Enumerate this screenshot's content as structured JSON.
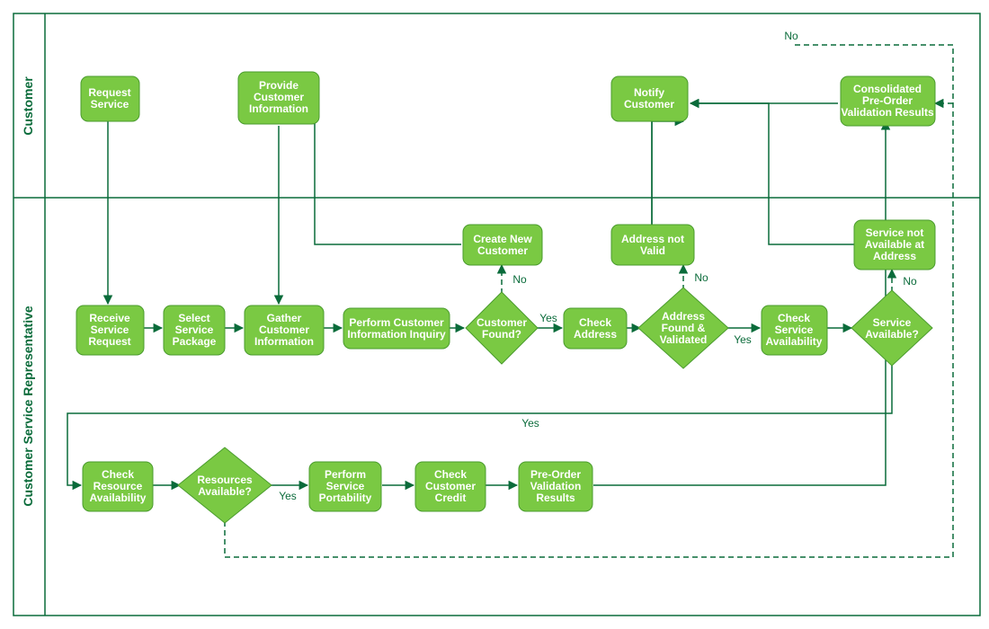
{
  "lanes": {
    "customer": "Customer",
    "csr": "Customer Service Representative"
  },
  "nodes": {
    "request_service": "Request\nService",
    "provide_customer_info": "Provide\nCustomer\nInformation",
    "notify_customer": "Notify\nCustomer",
    "consolidated_results": "Consolidated\nPre-Order\nValidation Results",
    "receive_service_request": "Receive\nService\nRequest",
    "select_service_package": "Select\nService\nPackage",
    "gather_customer_info": "Gather\nCustomer\nInformation",
    "perform_customer_inquiry": "Perform Customer\nInformation Inquiry",
    "customer_found": "Customer\nFound?",
    "create_new_customer": "Create New\nCustomer",
    "check_address": "Check\nAddress",
    "address_validated": "Address\nFound &\nValidated",
    "address_not_valid": "Address not\nValid",
    "check_service_avail": "Check\nService\nAvailability",
    "service_available": "Service\nAvailable?",
    "service_not_available": "Service not\nAvailable at\nAddress",
    "check_resource_avail": "Check\nResource\nAvailability",
    "resources_available": "Resources\nAvailable?",
    "perform_service_portability": "Perform\nService\nPortability",
    "check_customer_credit": "Check\nCustomer\nCredit",
    "preorder_validation_results": "Pre-Order\nValidation\nResults"
  },
  "labels": {
    "yes": "Yes",
    "no": "No"
  },
  "colors": {
    "node_fill": "#7ac943",
    "node_stroke": "#4a9c2e",
    "line": "#0a6b3a"
  },
  "chart_data": {
    "type": "flowchart_swimlane",
    "orientation": "horizontal",
    "lanes": [
      {
        "id": "customer",
        "label": "Customer"
      },
      {
        "id": "csr",
        "label": "Customer Service Representative"
      }
    ],
    "nodes": [
      {
        "id": "request_service",
        "lane": "customer",
        "type": "process",
        "label": "Request Service"
      },
      {
        "id": "provide_customer_info",
        "lane": "customer",
        "type": "process",
        "label": "Provide Customer Information"
      },
      {
        "id": "notify_customer",
        "lane": "customer",
        "type": "process",
        "label": "Notify Customer"
      },
      {
        "id": "consolidated_results",
        "lane": "customer",
        "type": "process",
        "label": "Consolidated Pre-Order Validation Results"
      },
      {
        "id": "receive_service_request",
        "lane": "csr",
        "type": "process",
        "label": "Receive Service Request"
      },
      {
        "id": "select_service_package",
        "lane": "csr",
        "type": "process",
        "label": "Select Service Package"
      },
      {
        "id": "gather_customer_info",
        "lane": "csr",
        "type": "process",
        "label": "Gather Customer Information"
      },
      {
        "id": "perform_customer_inquiry",
        "lane": "csr",
        "type": "process",
        "label": "Perform Customer Information Inquiry"
      },
      {
        "id": "customer_found",
        "lane": "csr",
        "type": "decision",
        "label": "Customer Found?"
      },
      {
        "id": "create_new_customer",
        "lane": "csr",
        "type": "process",
        "label": "Create New Customer"
      },
      {
        "id": "check_address",
        "lane": "csr",
        "type": "process",
        "label": "Check Address"
      },
      {
        "id": "address_validated",
        "lane": "csr",
        "type": "decision",
        "label": "Address Found & Validated"
      },
      {
        "id": "address_not_valid",
        "lane": "csr",
        "type": "process",
        "label": "Address not Valid"
      },
      {
        "id": "check_service_avail",
        "lane": "csr",
        "type": "process",
        "label": "Check Service Availability"
      },
      {
        "id": "service_available",
        "lane": "csr",
        "type": "decision",
        "label": "Service Available?"
      },
      {
        "id": "service_not_available",
        "lane": "csr",
        "type": "process",
        "label": "Service not Available at Address"
      },
      {
        "id": "check_resource_avail",
        "lane": "csr",
        "type": "process",
        "label": "Check Resource Availability"
      },
      {
        "id": "resources_available",
        "lane": "csr",
        "type": "decision",
        "label": "Resources Available?"
      },
      {
        "id": "perform_service_portability",
        "lane": "csr",
        "type": "process",
        "label": "Perform Service Portability"
      },
      {
        "id": "check_customer_credit",
        "lane": "csr",
        "type": "process",
        "label": "Check Customer Credit"
      },
      {
        "id": "preorder_validation_results",
        "lane": "csr",
        "type": "process",
        "label": "Pre-Order Validation Results"
      }
    ],
    "edges": [
      {
        "from": "request_service",
        "to": "receive_service_request"
      },
      {
        "from": "receive_service_request",
        "to": "select_service_package"
      },
      {
        "from": "select_service_package",
        "to": "gather_customer_info"
      },
      {
        "from": "provide_customer_info",
        "to": "gather_customer_info"
      },
      {
        "from": "gather_customer_info",
        "to": "perform_customer_inquiry"
      },
      {
        "from": "perform_customer_inquiry",
        "to": "customer_found"
      },
      {
        "from": "customer_found",
        "to": "check_address",
        "label": "Yes"
      },
      {
        "from": "customer_found",
        "to": "create_new_customer",
        "label": "No",
        "style": "dashed"
      },
      {
        "from": "create_new_customer",
        "to": "provide_customer_info"
      },
      {
        "from": "check_address",
        "to": "address_validated"
      },
      {
        "from": "address_validated",
        "to": "check_service_avail",
        "label": "Yes"
      },
      {
        "from": "address_validated",
        "to": "address_not_valid",
        "label": "No",
        "style": "dashed"
      },
      {
        "from": "address_not_valid",
        "to": "notify_customer"
      },
      {
        "from": "check_service_avail",
        "to": "service_available"
      },
      {
        "from": "service_available",
        "to": "service_not_available",
        "label": "No",
        "style": "dashed"
      },
      {
        "from": "service_not_available",
        "to": "notify_customer"
      },
      {
        "from": "service_available",
        "to": "check_resource_avail",
        "label": "Yes"
      },
      {
        "from": "check_resource_avail",
        "to": "resources_available"
      },
      {
        "from": "resources_available",
        "to": "perform_service_portability",
        "label": "Yes"
      },
      {
        "from": "resources_available",
        "to": "consolidated_results",
        "label": "No",
        "style": "dashed"
      },
      {
        "from": "perform_service_portability",
        "to": "check_customer_credit"
      },
      {
        "from": "check_customer_credit",
        "to": "preorder_validation_results"
      },
      {
        "from": "preorder_validation_results",
        "to": "consolidated_results"
      },
      {
        "from": "consolidated_results",
        "to": "notify_customer"
      }
    ]
  }
}
